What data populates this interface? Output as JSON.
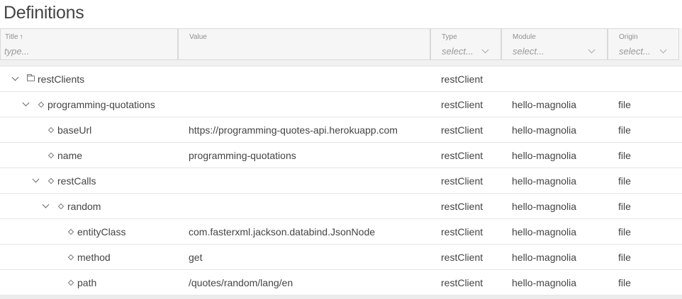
{
  "page_title": "Definitions",
  "columns": {
    "title": {
      "label": "Title",
      "sort_icon": "↑",
      "placeholder": "type..."
    },
    "value": {
      "label": "Value"
    },
    "type": {
      "label": "Type",
      "select": "select..."
    },
    "module": {
      "label": "Module",
      "select": "select..."
    },
    "origin": {
      "label": "Origin",
      "select": "select..."
    }
  },
  "rows": [
    {
      "title": "restClients",
      "value": "",
      "type": "restClient",
      "module": "",
      "origin": "",
      "icon": "folder-icon",
      "expanded": true
    },
    {
      "title": "programming-quotations",
      "value": "",
      "type": "restClient",
      "module": "hello-magnolia",
      "origin": "file",
      "icon": "node-icon",
      "expanded": true
    },
    {
      "title": "baseUrl",
      "value": "https://programming-quotes-api.herokuapp.com",
      "type": "restClient",
      "module": "hello-magnolia",
      "origin": "file",
      "icon": "node-icon"
    },
    {
      "title": "name",
      "value": "programming-quotations",
      "type": "restClient",
      "module": "hello-magnolia",
      "origin": "file",
      "icon": "node-icon"
    },
    {
      "title": "restCalls",
      "value": "",
      "type": "restClient",
      "module": "hello-magnolia",
      "origin": "file",
      "icon": "node-icon",
      "expanded": true
    },
    {
      "title": "random",
      "value": "",
      "type": "restClient",
      "module": "hello-magnolia",
      "origin": "file",
      "icon": "node-icon",
      "expanded": true
    },
    {
      "title": "entityClass",
      "value": "com.fasterxml.jackson.databind.JsonNode",
      "type": "restClient",
      "module": "hello-magnolia",
      "origin": "file",
      "icon": "node-icon"
    },
    {
      "title": "method",
      "value": "get",
      "type": "restClient",
      "module": "hello-magnolia",
      "origin": "file",
      "icon": "node-icon"
    },
    {
      "title": "path",
      "value": "/quotes/random/lang/en",
      "type": "restClient",
      "module": "hello-magnolia",
      "origin": "file",
      "icon": "node-icon"
    }
  ]
}
